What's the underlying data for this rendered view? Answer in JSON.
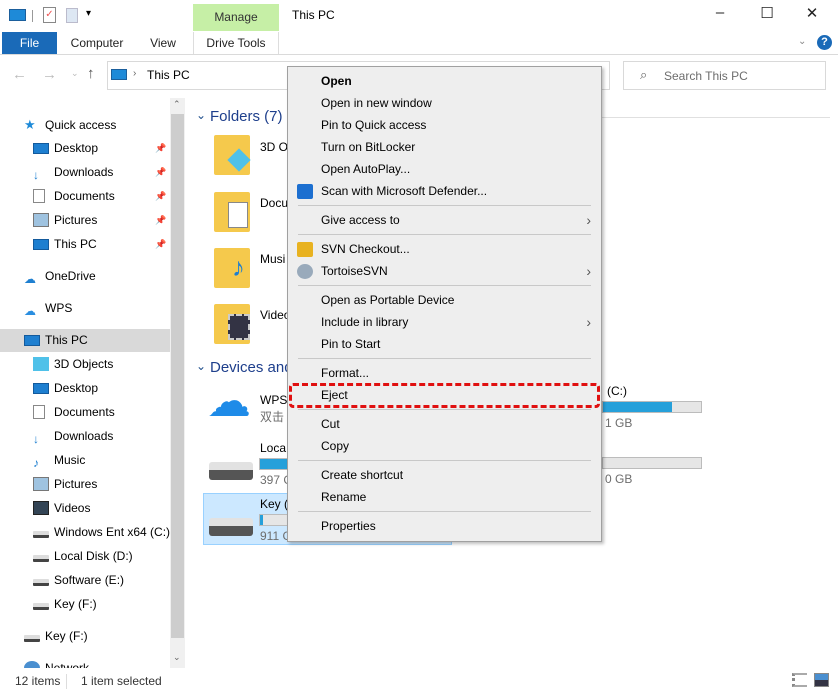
{
  "window": {
    "title": "This PC",
    "context_tab": "Manage"
  },
  "ribbon": {
    "tabs": [
      "File",
      "Computer",
      "View",
      "Drive Tools"
    ]
  },
  "address": {
    "path": "This PC",
    "search_placeholder": "Search This PC"
  },
  "sidebar": {
    "items": [
      {
        "label": "Quick access",
        "pinned": false
      },
      {
        "label": "Desktop",
        "pinned": true
      },
      {
        "label": "Downloads",
        "pinned": true
      },
      {
        "label": "Documents",
        "pinned": true
      },
      {
        "label": "Pictures",
        "pinned": true
      },
      {
        "label": "This PC",
        "pinned": true
      },
      {
        "label": "OneDrive"
      },
      {
        "label": "WPS"
      },
      {
        "label": "This PC",
        "selected": true
      },
      {
        "label": "3D Objects"
      },
      {
        "label": "Desktop"
      },
      {
        "label": "Documents"
      },
      {
        "label": "Downloads"
      },
      {
        "label": "Music"
      },
      {
        "label": "Pictures"
      },
      {
        "label": "Videos"
      },
      {
        "label": "Windows Ent x64 (C:)"
      },
      {
        "label": "Local Disk (D:)"
      },
      {
        "label": "Software (E:)"
      },
      {
        "label": "Key (F:)"
      },
      {
        "label": "Key (F:)"
      },
      {
        "label": "Network"
      }
    ]
  },
  "main": {
    "folders_header": "Folders (7)",
    "folders": [
      "3D O",
      "Docu",
      "Musi",
      "Video"
    ],
    "devices_header": "Devices and",
    "drives": [
      {
        "name": "WPS",
        "sub": "双击"
      },
      {
        "name": "Loca",
        "size": "397 G",
        "used_fraction": 0.6
      },
      {
        "name": "Key (",
        "size": "911 G",
        "used_fraction": 0.05,
        "selected": true
      }
    ],
    "right_drives": [
      {
        "name": "(C:)",
        "size": "1 GB",
        "used_fraction": 0.7
      },
      {
        "name": "",
        "size": "0 GB",
        "used_fraction": 0.0
      }
    ]
  },
  "context_menu": {
    "items": [
      {
        "label": "Open",
        "bold": true
      },
      {
        "label": "Open in new window"
      },
      {
        "label": "Pin to Quick access"
      },
      {
        "label": "Turn on BitLocker"
      },
      {
        "label": "Open AutoPlay..."
      },
      {
        "label": "Scan with Microsoft Defender...",
        "icon": "defender-icon"
      },
      {
        "sep": true
      },
      {
        "label": "Give access to",
        "submenu": true
      },
      {
        "sep": true
      },
      {
        "label": "SVN Checkout...",
        "icon": "svn-checkout-icon"
      },
      {
        "label": "TortoiseSVN",
        "icon": "tortoisesvn-icon",
        "submenu": true
      },
      {
        "sep": true
      },
      {
        "label": "Open as Portable Device"
      },
      {
        "label": "Include in library",
        "submenu": true
      },
      {
        "label": "Pin to Start"
      },
      {
        "sep": true
      },
      {
        "label": "Format..."
      },
      {
        "label": "Eject",
        "highlighted": true
      },
      {
        "sep": true
      },
      {
        "label": "Cut"
      },
      {
        "label": "Copy"
      },
      {
        "sep": true
      },
      {
        "label": "Create shortcut"
      },
      {
        "label": "Rename"
      },
      {
        "sep": true
      },
      {
        "label": "Properties"
      }
    ]
  },
  "status": {
    "count": "12 items",
    "selection": "1 item selected"
  },
  "colors": {
    "accent": "#0063b1",
    "manage_tab": "#c6efa6",
    "highlight": "#e01010",
    "selection": "#cce8ff",
    "bar": "#26a0da"
  }
}
